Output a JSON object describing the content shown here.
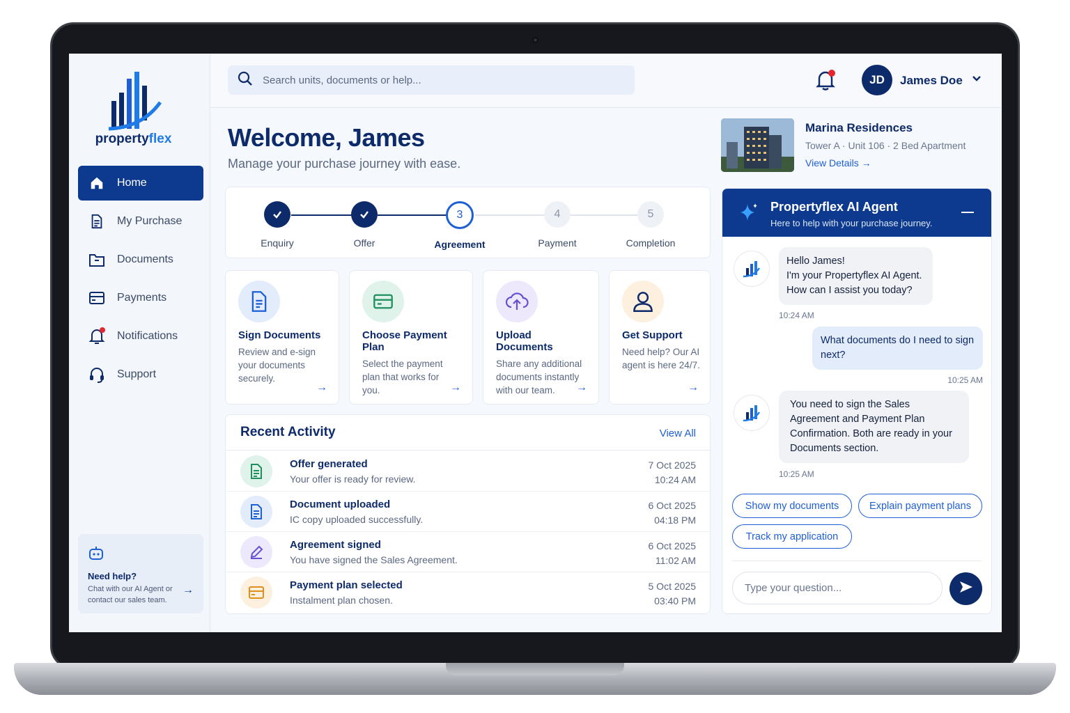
{
  "brand": {
    "name_part1": "property",
    "name_part2": "flex"
  },
  "sidebar": {
    "items": [
      {
        "label": "Home",
        "icon": "home-icon",
        "active": true
      },
      {
        "label": "My Purchase",
        "icon": "document-icon"
      },
      {
        "label": "Documents",
        "icon": "folder-icon"
      },
      {
        "label": "Payments",
        "icon": "card-icon"
      },
      {
        "label": "Notifications",
        "icon": "bell-icon"
      },
      {
        "label": "Support",
        "icon": "headset-icon"
      }
    ],
    "help": {
      "title": "Need help?",
      "text": "Chat with our AI Agent or contact our sales team."
    }
  },
  "topbar": {
    "search_placeholder": "Search units, documents or help...",
    "user_initials": "JD",
    "user_name": "James Doe"
  },
  "welcome": {
    "title": "Welcome, James",
    "subtitle": "Manage your purchase journey with ease."
  },
  "property": {
    "name": "Marina Residences",
    "meta": "Tower A · Unit 106 · 2 Bed Apartment",
    "link": "View Details"
  },
  "steps": [
    {
      "num": "1",
      "label": "Enquiry",
      "state": "done"
    },
    {
      "num": "2",
      "label": "Offer",
      "state": "done"
    },
    {
      "num": "3",
      "label": "Agreement",
      "state": "current"
    },
    {
      "num": "4",
      "label": "Payment",
      "state": "todo"
    },
    {
      "num": "5",
      "label": "Completion",
      "state": "todo"
    }
  ],
  "cards": [
    {
      "title": "Sign Documents",
      "desc": "Review and e-sign your documents securely.",
      "icon": "sign-document-icon"
    },
    {
      "title": "Choose Payment Plan",
      "desc": "Select the payment plan that works for you.",
      "icon": "payment-card-icon"
    },
    {
      "title": "Upload Documents",
      "desc": "Share any additional documents instantly with our team.",
      "icon": "cloud-upload-icon"
    },
    {
      "title": "Get Support",
      "desc": "Need help? Our AI agent is here 24/7.",
      "icon": "user-support-icon"
    }
  ],
  "recent": {
    "title": "Recent Activity",
    "view_all": "View All",
    "items": [
      {
        "title": "Offer generated",
        "desc": "Your offer is ready for review.",
        "date": "7 Oct 2025",
        "time": "10:24 AM"
      },
      {
        "title": "Document uploaded",
        "desc": "IC copy uploaded successfully.",
        "date": "6 Oct 2025",
        "time": "04:18 PM"
      },
      {
        "title": "Agreement signed",
        "desc": "You have signed the Sales Agreement.",
        "date": "6 Oct 2025",
        "time": "11:02 AM"
      },
      {
        "title": "Payment plan selected",
        "desc": "Instalment plan chosen.",
        "date": "5 Oct 2025",
        "time": "03:40 PM"
      }
    ]
  },
  "ai": {
    "title": "Propertyflex AI Agent",
    "subtitle": "Here to help with your purchase journey.",
    "messages": [
      {
        "from": "bot",
        "text1": "Hello James!",
        "text2": "I'm your Propertyflex AI Agent.",
        "text3": "How can I assist you today?",
        "time": "10:24 AM"
      },
      {
        "from": "user",
        "text": "What documents do I need to sign next?",
        "time": "10:25 AM"
      },
      {
        "from": "bot",
        "text": "You need to sign the Sales Agreement and Payment Plan Confirmation. Both are ready in your Documents section.",
        "time": "10:25 AM"
      }
    ],
    "chips": [
      "Show my documents",
      "Explain payment plans",
      "Track my application"
    ],
    "input_placeholder": "Type your question..."
  },
  "colors": {
    "primary": "#0d3a8f",
    "accent": "#1e5fd6",
    "notification": "#e5262e"
  }
}
